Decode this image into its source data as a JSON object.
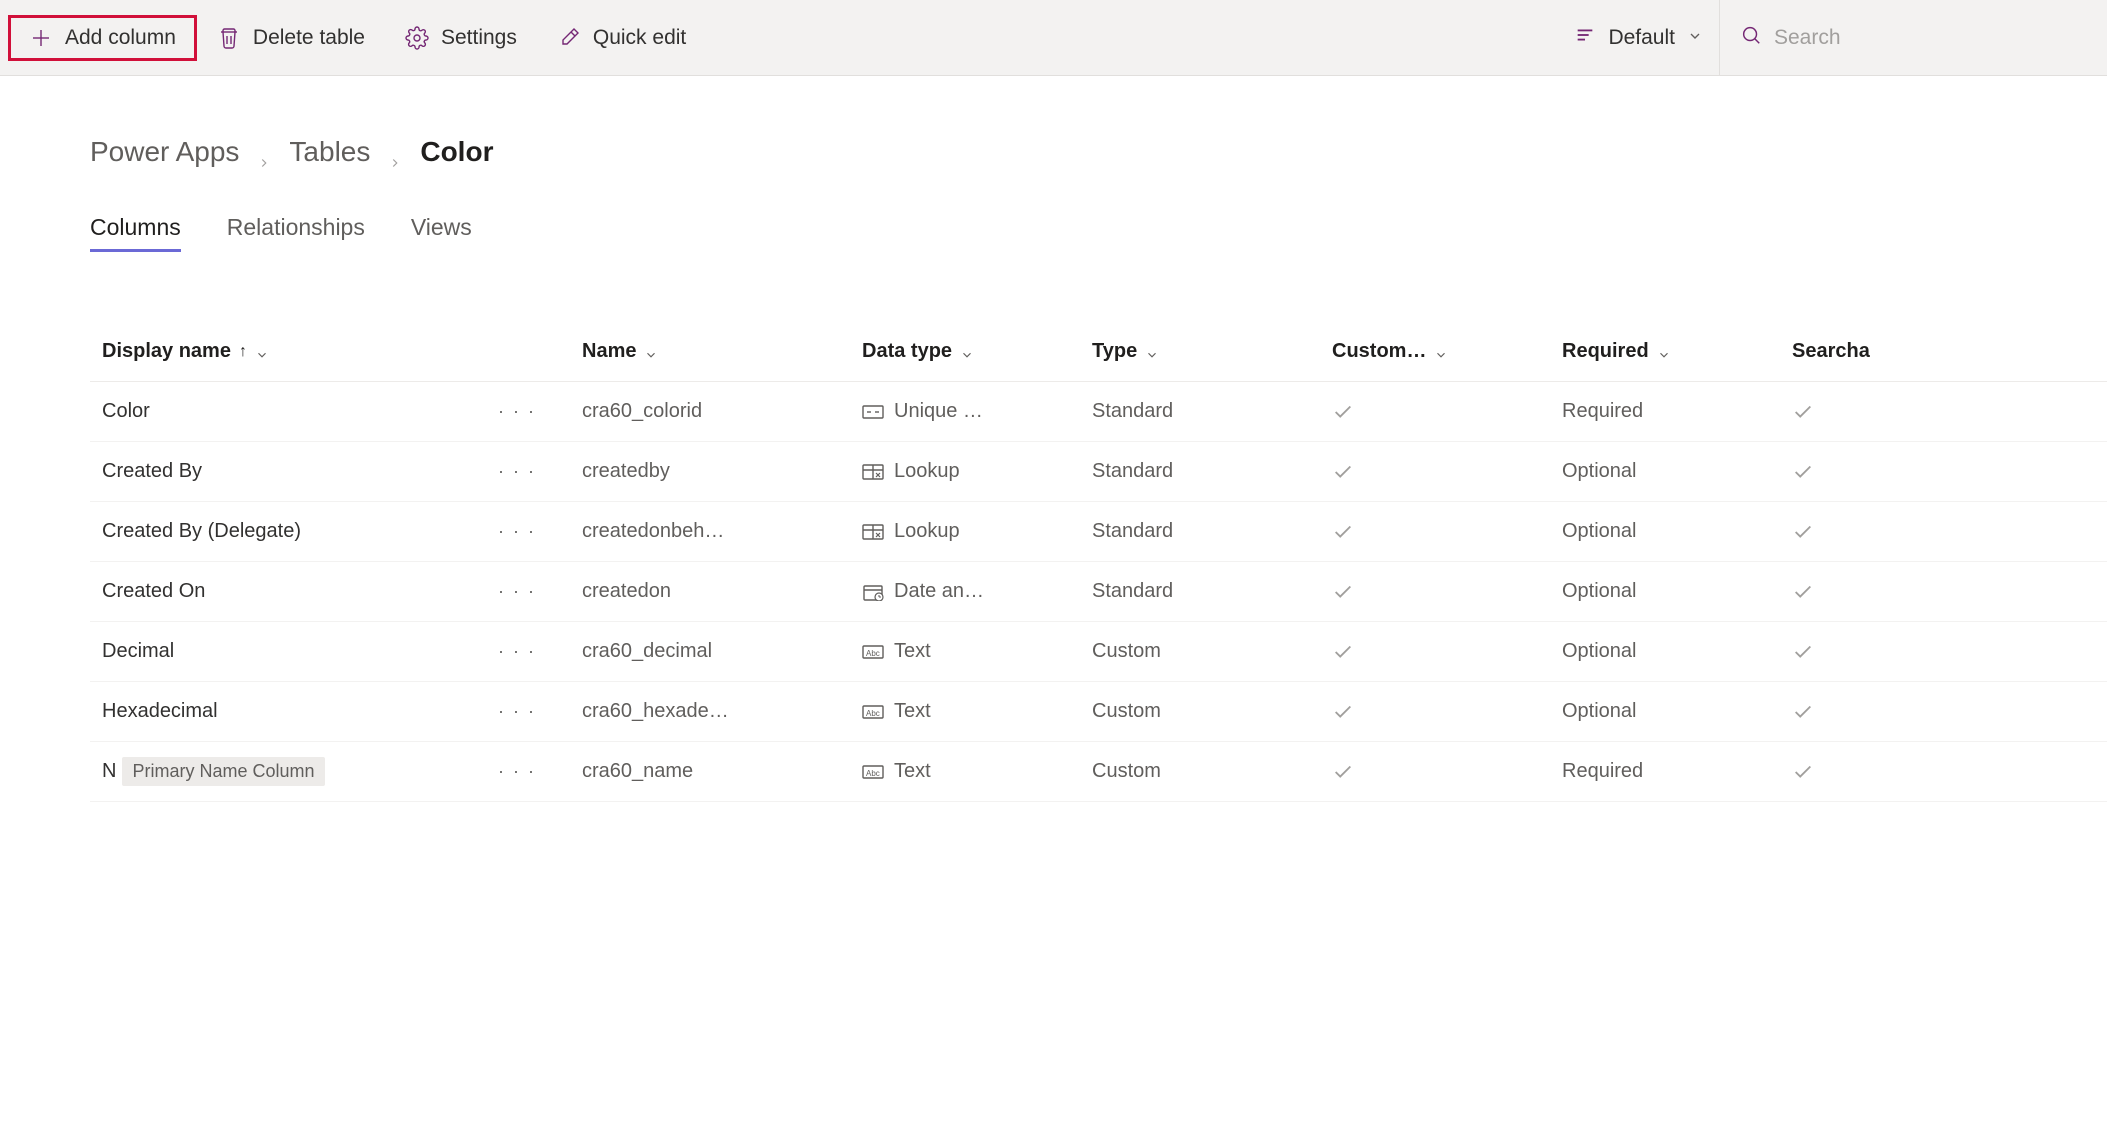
{
  "toolbar": {
    "add_column": "Add column",
    "delete_table": "Delete table",
    "settings": "Settings",
    "quick_edit": "Quick edit",
    "view_name": "Default",
    "search_placeholder": "Search"
  },
  "breadcrumb": {
    "root": "Power Apps",
    "parent": "Tables",
    "current": "Color"
  },
  "tabs": {
    "columns": "Columns",
    "relationships": "Relationships",
    "views": "Views"
  },
  "headers": {
    "display_name": "Display name",
    "name": "Name",
    "data_type": "Data type",
    "type": "Type",
    "custom": "Custom…",
    "required": "Required",
    "searchable": "Searcha"
  },
  "rows": [
    {
      "display": "Color",
      "badge": "",
      "name": "cra60_colorid",
      "dt_icon": "unique",
      "dt": "Unique …",
      "type": "Standard",
      "custom": true,
      "required": "Required",
      "searchable": true
    },
    {
      "display": "Created By",
      "badge": "",
      "name": "createdby",
      "dt_icon": "lookup",
      "dt": "Lookup",
      "type": "Standard",
      "custom": true,
      "required": "Optional",
      "searchable": true
    },
    {
      "display": "Created By (Delegate)",
      "badge": "",
      "name": "createdonbeh…",
      "dt_icon": "lookup",
      "dt": "Lookup",
      "type": "Standard",
      "custom": true,
      "required": "Optional",
      "searchable": true
    },
    {
      "display": "Created On",
      "badge": "",
      "name": "createdon",
      "dt_icon": "date",
      "dt": "Date an…",
      "type": "Standard",
      "custom": true,
      "required": "Optional",
      "searchable": true
    },
    {
      "display": "Decimal",
      "badge": "",
      "name": "cra60_decimal",
      "dt_icon": "text",
      "dt": "Text",
      "type": "Custom",
      "custom": true,
      "required": "Optional",
      "searchable": true
    },
    {
      "display": "Hexadecimal",
      "badge": "",
      "name": "cra60_hexade…",
      "dt_icon": "text",
      "dt": "Text",
      "type": "Custom",
      "custom": true,
      "required": "Optional",
      "searchable": true
    },
    {
      "display": "N",
      "badge": "Primary Name Column",
      "name": "cra60_name",
      "dt_icon": "text",
      "dt": "Text",
      "type": "Custom",
      "custom": true,
      "required": "Required",
      "searchable": true
    }
  ]
}
